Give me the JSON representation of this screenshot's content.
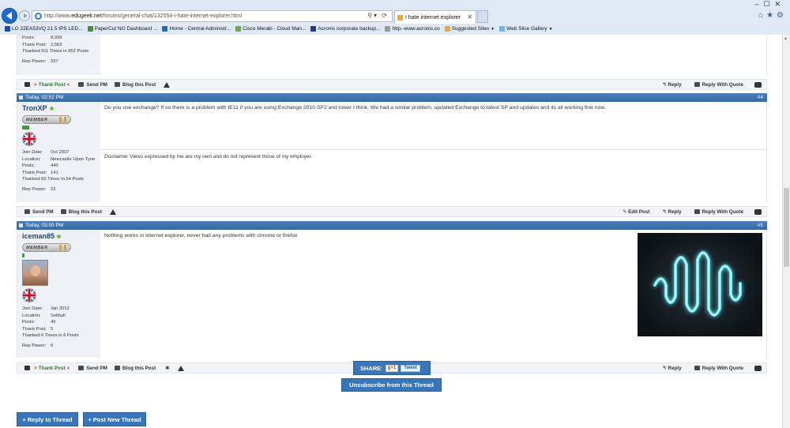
{
  "browser": {
    "url_prefix": "http://www.",
    "url_domain": "edugeek.net",
    "url_path": "/forums/general-chat/132554-i-hate-internet-explorer.html",
    "tab_title": "I hate internet explorer",
    "favorites": [
      {
        "label": "LG 22EA53VQ 21.5 IPS LED...",
        "icon": "m-icon",
        "color": "#1c4da1"
      },
      {
        "label": "PaperCut NG  Dashboard ...",
        "icon": "papercut-icon",
        "color": "#4a8f2d"
      },
      {
        "label": "Home - Central Administr...",
        "icon": "sharepoint-icon",
        "color": "#1b6ac9"
      },
      {
        "label": "Cisco Meraki - Cloud Man...",
        "icon": "meraki-icon",
        "color": "#6aa84f"
      },
      {
        "label": "Acronis corporate backup...",
        "icon": "acronis-icon",
        "color": "#1b3e8a"
      },
      {
        "label": "http--www.acronis.co",
        "icon": "page-icon",
        "color": "#999999"
      },
      {
        "label": "Suggested Sites",
        "icon": "suggested-icon",
        "color": "#f3a531",
        "dropdown": true
      },
      {
        "label": "Web Slice Gallery",
        "icon": "webslice-icon",
        "color": "#7ab3e0",
        "dropdown": true
      }
    ]
  },
  "top_post": {
    "stats": [
      {
        "k": "Posts:",
        "v": "8,939"
      },
      {
        "k": "Thank Post:",
        "v": "2,563"
      }
    ],
    "thanked": "Thanked 911 Times in 852 Posts",
    "rep_label": "Rep Power:",
    "rep_value": "337",
    "footer": {
      "thank": "Thank Post",
      "send_pm": "Send PM",
      "blog": "Blog this Post",
      "reply": "Reply",
      "reply_quote": "Reply With Quote"
    }
  },
  "posts": [
    {
      "date": "Today, 02:52 PM",
      "number": "#4",
      "username": "TronXP",
      "rank": "MEMBER",
      "stats": [
        {
          "k": "Join Date:",
          "v": "Oct 2007"
        },
        {
          "k": "Location:",
          "v": "Newcastle Upon Tyne"
        },
        {
          "k": "Posts:",
          "v": "440"
        },
        {
          "k": "Thank Post:",
          "v": "141"
        }
      ],
      "thanked": "Thanked 60 Times in 54 Posts",
      "rep_label": "Rep Power:",
      "rep_value": "22",
      "content": "Do you use exchange? If so there is a problem with IE11 if you are using Exchange 2010 SP2 and lower I think. We had a similar problem, updated Exchange to latest SP and updates and its all working fine now.",
      "signature_label": "Disclaimer",
      "signature_text": " Views expressed by me are my own and do not represent those of my employer.",
      "footer": {
        "send_pm": "Send PM",
        "blog": "Blog this Post",
        "edit": "Edit Post",
        "reply": "Reply",
        "reply_quote": "Reply With Quote"
      }
    },
    {
      "date": "Today, 03:00 PM",
      "number": "#5",
      "username": "iceman85",
      "rank": "MEMBER",
      "stats": [
        {
          "k": "Join Date:",
          "v": "Jan 2012"
        },
        {
          "k": "Location:",
          "v": "Solihull"
        },
        {
          "k": "Posts:",
          "v": "45"
        },
        {
          "k": "Thank Post:",
          "v": "5"
        }
      ],
      "thanked": "Thanked 6 Times in 6 Posts",
      "rep_label": "Rep Power:",
      "rep_value": "6",
      "content": "Nothing works in internet explorer, never had any problems with chrome or firefox",
      "footer": {
        "thank": "Thank Post",
        "send_pm": "Send PM",
        "blog": "Blog this Post",
        "reply": "Reply",
        "reply_quote": "Reply With Quote"
      }
    }
  ],
  "actions": {
    "unsubscribe": "Unsubscribe from this Thread",
    "share_label": "SHARE:",
    "gplus": "g+1",
    "tweet": "Tweet",
    "reply_thread": "+ Reply to Thread",
    "new_thread": "+ Post New Thread"
  }
}
